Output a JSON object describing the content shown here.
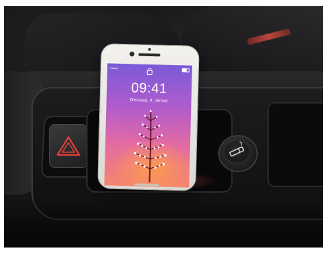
{
  "phone": {
    "lock_screen": {
      "time": "09:41",
      "date": "Dienstag, 9. Januar"
    }
  },
  "colors": {
    "screen_top": "#7b5ad8",
    "screen_bottom": "#f5866d",
    "hazard_symbol": "#e0413a",
    "seat_stripe": "#b9473e"
  },
  "icons": [
    "lock-icon",
    "battery-icon",
    "hazard-warning-icon",
    "cigarette-lighter-icon"
  ]
}
